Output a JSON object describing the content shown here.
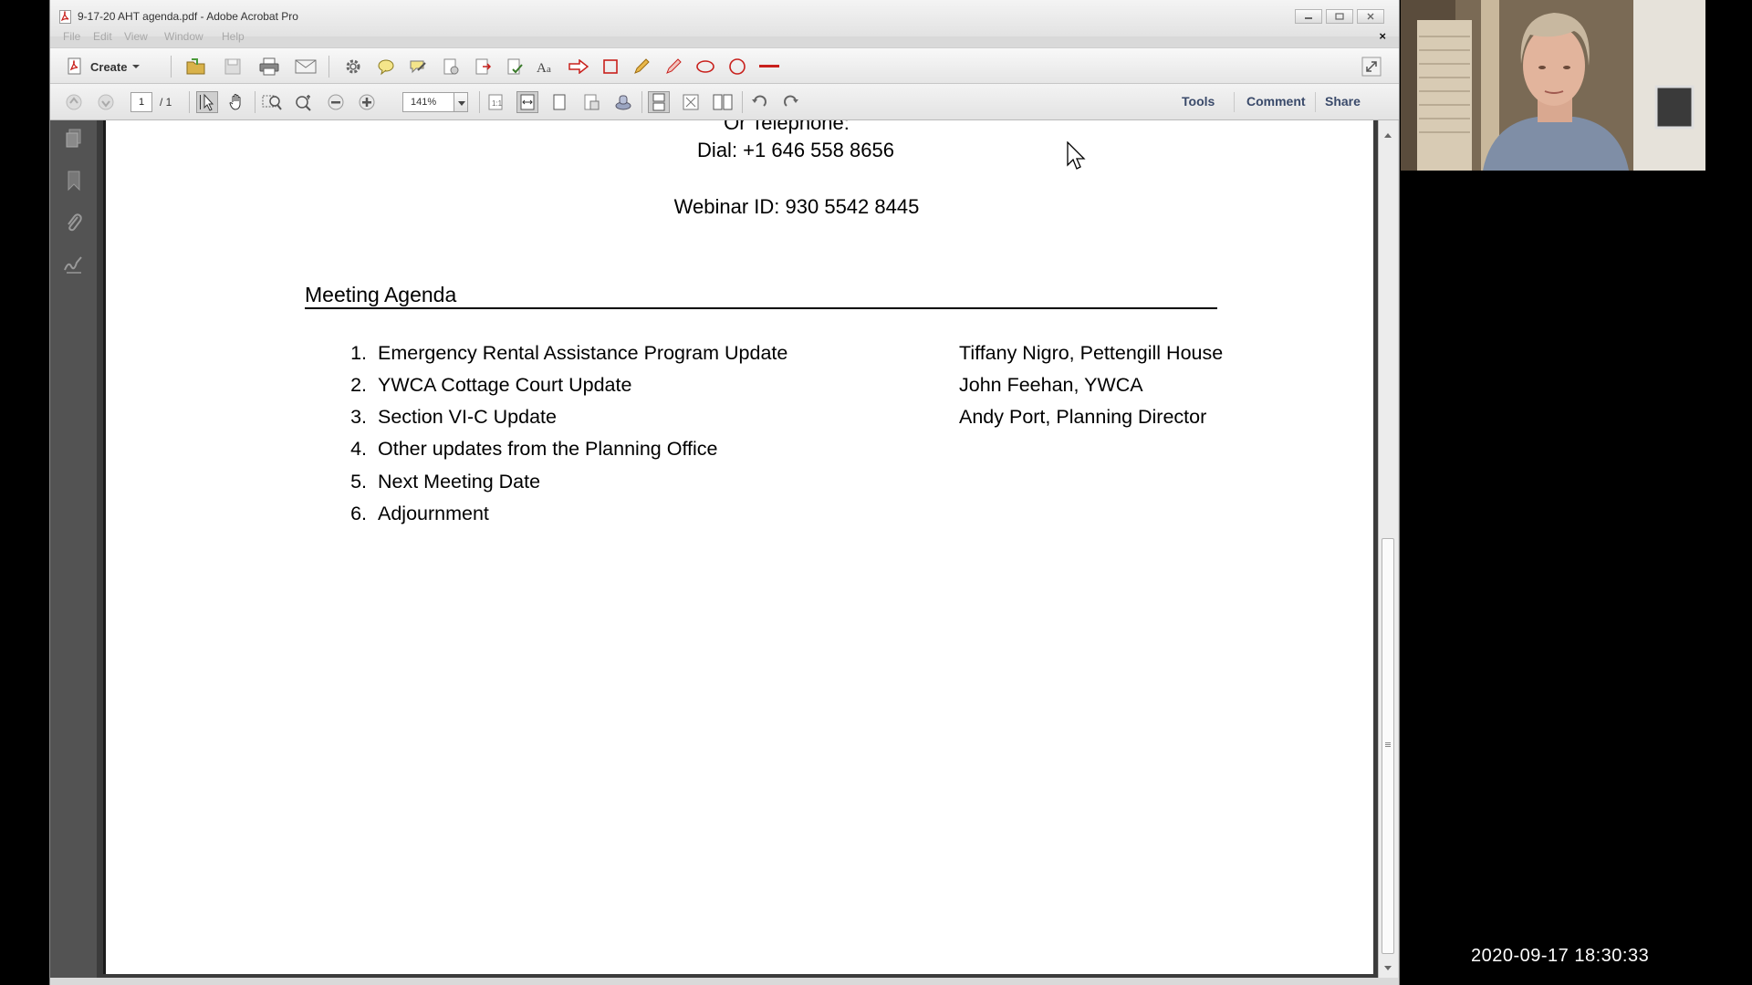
{
  "window": {
    "title": "9-17-20 AHT agenda.pdf - Adobe Acrobat Pro",
    "menu": [
      "File",
      "Edit",
      "View",
      "Window",
      "Help"
    ],
    "close_doc": "×"
  },
  "toolbar": {
    "create_label": "Create",
    "page_current": "1",
    "page_total": "/ 1",
    "zoom": "141%",
    "tools_label": "Tools",
    "comment_label": "Comment",
    "share_label": "Share"
  },
  "document": {
    "telephone_heading": "Or Telephone:",
    "dial": "Dial: +1 646 558 8656",
    "webinar": "Webinar ID: 930 5542 8445",
    "agenda_title": "Meeting Agenda",
    "items": [
      {
        "num": "1.",
        "text": "Emergency Rental Assistance Program Update",
        "presenter": "Tiffany Nigro, Pettengill House"
      },
      {
        "num": "2.",
        "text": "YWCA Cottage Court  Update",
        "presenter": "John Feehan, YWCA"
      },
      {
        "num": "3.",
        "text": "Section VI-C Update",
        "presenter": "Andy Port, Planning Director"
      },
      {
        "num": "4.",
        "text": "Other updates from the Planning Office",
        "presenter": ""
      },
      {
        "num": "5.",
        "text": "Next Meeting Date",
        "presenter": ""
      },
      {
        "num": "6.",
        "text": "Adjournment",
        "presenter": ""
      }
    ]
  },
  "recording": {
    "timestamp": "2020-09-17  18:30:33"
  },
  "colors": {
    "acrobat_red": "#c8201c",
    "nav_pane": "#535353",
    "link_text": "#3a4a6a"
  }
}
